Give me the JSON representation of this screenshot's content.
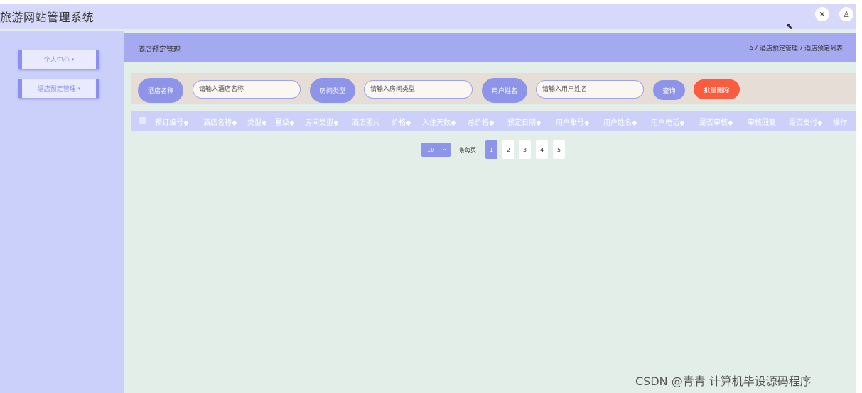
{
  "app": {
    "title": "旅游网站管理系统"
  },
  "header": {
    "fullscreen_icon": "✕",
    "user_icon": "♙",
    "cursor_icon": "⬉"
  },
  "sidebar": {
    "items": [
      {
        "label": "个人中心",
        "caret": "▾"
      },
      {
        "label": "酒店预定管理",
        "caret": "▾"
      }
    ]
  },
  "main": {
    "title": "酒店预定管理",
    "breadcrumb": {
      "home_icon": "⌂",
      "sep": "/",
      "level1": "酒店预定管理",
      "level2": "酒店预定列表"
    }
  },
  "search": {
    "hotel_name_label": "酒店名称",
    "hotel_name_placeholder": "请输入酒店名称",
    "room_type_label": "房间类型",
    "room_type_placeholder": "请输入房间类型",
    "user_name_label": "用户姓名",
    "user_name_placeholder": "请输入用户姓名",
    "query_button": "查询",
    "batch_delete_button": "批量删除"
  },
  "table": {
    "columns": [
      "预订编号◆",
      "酒店名称◆",
      "类型◆",
      "星级◆",
      "房间类型◆",
      "酒店图片",
      "价格◆",
      "入住天数◆",
      "总价格◆",
      "预定日期◆",
      "用户账号◆",
      "用户姓名◆",
      "用户电话◆",
      "是否审核◆",
      "审核回复",
      "是否支付◆",
      "操作"
    ]
  },
  "pagination": {
    "page_size": "10",
    "page_size_chevron": "⌄",
    "per_page_label": "条每页",
    "pages": [
      "1",
      "2",
      "3",
      "4",
      "5"
    ],
    "current_page": "1"
  },
  "watermark": "CSDN @青青  计算机毕设源码程序",
  "colors": {
    "header_bg": "#d6d9fa",
    "sidebar_bg": "#cbd0fb",
    "accent": "#8e94e8",
    "main_bg": "#e3eee8",
    "danger": "#fb5b3f"
  }
}
